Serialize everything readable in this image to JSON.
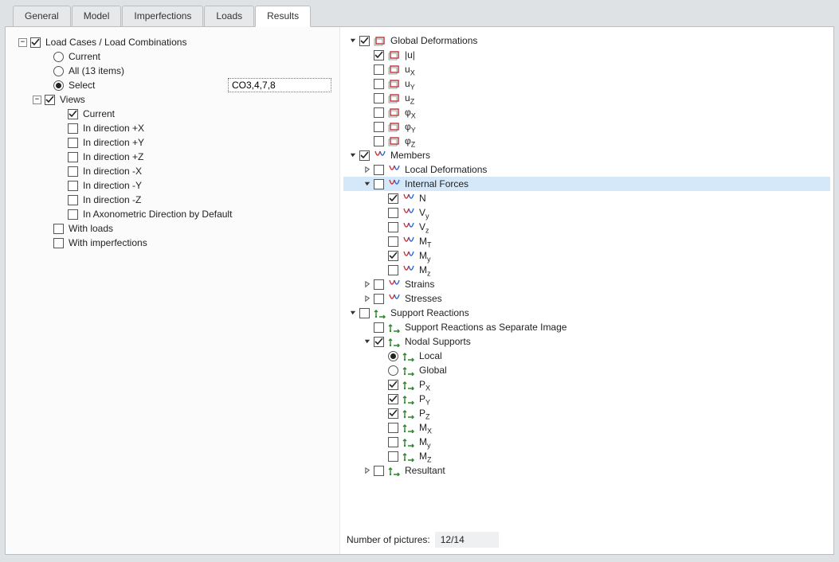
{
  "tabs": {
    "general": "General",
    "model": "Model",
    "imperfections": "Imperfections",
    "loads": "Loads",
    "results": "Results"
  },
  "left_tree": {
    "load_cases": "Load Cases / Load Combinations",
    "radio_current": "Current",
    "radio_all": "All (13 items)",
    "radio_select": "Select",
    "select_value": "CO3,4,7,8",
    "views": "Views",
    "view_current": "Current",
    "dir_px": "In direction +X",
    "dir_py": "In direction +Y",
    "dir_pz": "In direction +Z",
    "dir_mx": "In direction -X",
    "dir_my": "In direction -Y",
    "dir_mz": "In direction -Z",
    "axo": "In Axonometric Direction by Default",
    "with_loads": "With loads",
    "with_imperfections": "With imperfections"
  },
  "right_tree": {
    "global_def": "Global Deformations",
    "u_abs": "|u|",
    "ux_pre": "u",
    "ux_sub": "X",
    "uy_pre": "u",
    "uy_sub": "Y",
    "uz_pre": "u",
    "uz_sub": "Z",
    "phix_pre": "φ",
    "phix_sub": "X",
    "phiy_pre": "φ",
    "phiy_sub": "Y",
    "phiz_pre": "φ",
    "phiz_sub": "Z",
    "members": "Members",
    "local_def": "Local Deformations",
    "internal_forces": "Internal Forces",
    "n": "N",
    "vy_pre": "V",
    "vy_sub": "y",
    "vz_pre": "V",
    "vz_sub": "z",
    "mt_pre": "M",
    "mt_sub": "T",
    "my_pre": "M",
    "my_sub": "y",
    "mz_pre": "M",
    "mz_sub": "z",
    "strains": "Strains",
    "stresses": "Stresses",
    "support": "Support Reactions",
    "support_sep": "Support Reactions as Separate Image",
    "nodal_sup": "Nodal Supports",
    "local": "Local",
    "global": "Global",
    "px_pre": "P",
    "px_sub": "X",
    "py_pre": "P",
    "py_sub": "Y",
    "pz_pre": "P",
    "pz_sub": "Z",
    "mx_pre": "M",
    "mx_sub": "X",
    "my2_pre": "M",
    "my2_sub": "y",
    "mz2_pre": "M",
    "mz2_sub": "Z",
    "resultant": "Resultant"
  },
  "footer": {
    "label": "Number of pictures:",
    "value": "12/14"
  }
}
